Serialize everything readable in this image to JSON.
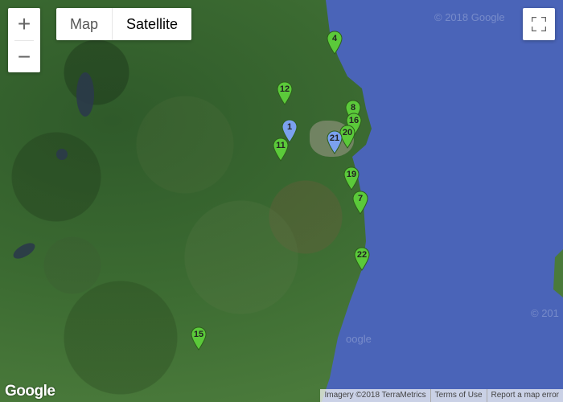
{
  "controls": {
    "zoom_in": "+",
    "zoom_out": "−",
    "map_type": {
      "options": [
        "Map",
        "Satellite"
      ],
      "selected": "Satellite"
    },
    "fullscreen_icon": "fullscreen-icon"
  },
  "watermarks": [
    "© 2018 Google",
    "oogle",
    "© 201"
  ],
  "markers": [
    {
      "label": "1",
      "color": "#7ba1ef"
    },
    {
      "label": "4",
      "color": "#5bc93a"
    },
    {
      "label": "7",
      "color": "#5bc93a"
    },
    {
      "label": "8",
      "color": "#5bc93a"
    },
    {
      "label": "11",
      "color": "#5bc93a"
    },
    {
      "label": "12",
      "color": "#5bc93a"
    },
    {
      "label": "15",
      "color": "#5bc93a"
    },
    {
      "label": "16",
      "color": "#5bc93a"
    },
    {
      "label": "19",
      "color": "#5bc93a"
    },
    {
      "label": "20",
      "color": "#5bc93a"
    },
    {
      "label": "21",
      "color": "#7ba1ef"
    },
    {
      "label": "22",
      "color": "#5bc93a"
    }
  ],
  "logo": "Google",
  "attribution": {
    "imagery": "Imagery ©2018 TerraMetrics",
    "terms": "Terms of Use",
    "report": "Report a map error"
  },
  "colors": {
    "sea": "#4a64b8",
    "land": "#3f6d34",
    "marker_green": "#5bc93a",
    "marker_blue": "#7ba1ef"
  }
}
